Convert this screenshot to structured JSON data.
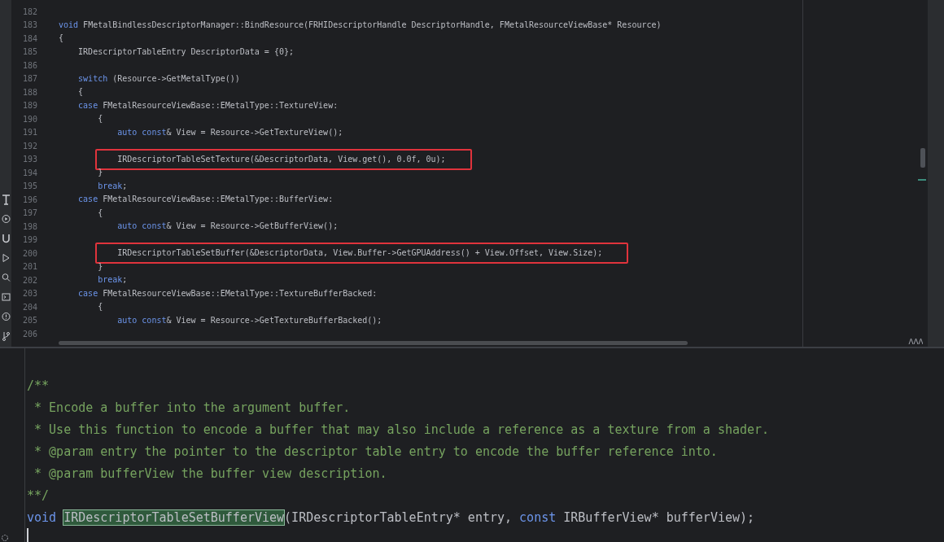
{
  "editor": {
    "lines": [
      {
        "number": "182"
      },
      {
        "number": "183",
        "tokens": [
          {
            "kind": "keyword",
            "text": "void"
          },
          {
            "kind": "plain",
            "text": " FMetalBindlessDescriptorManager::BindResource(FRHIDescriptorHandle DescriptorHandle, FMetalResourceViewBase* Resource)"
          }
        ]
      },
      {
        "number": "184",
        "tokens": [
          {
            "kind": "plain",
            "text": "{"
          }
        ]
      },
      {
        "number": "185",
        "tokens": [
          {
            "kind": "plain",
            "text": "    IRDescriptorTableEntry DescriptorData = {0};"
          }
        ]
      },
      {
        "number": "186"
      },
      {
        "number": "187",
        "tokens": [
          {
            "kind": "keyword",
            "text": "    switch"
          },
          {
            "kind": "plain",
            "text": " (Resource->GetMetalType())"
          }
        ]
      },
      {
        "number": "188",
        "tokens": [
          {
            "kind": "plain",
            "text": "    {"
          }
        ]
      },
      {
        "number": "189",
        "tokens": [
          {
            "kind": "keyword",
            "text": "    case"
          },
          {
            "kind": "plain",
            "text": " FMetalResourceViewBase::EMetalType::TextureView:"
          }
        ]
      },
      {
        "number": "190",
        "tokens": [
          {
            "kind": "plain",
            "text": "        {"
          }
        ]
      },
      {
        "number": "191",
        "tokens": [
          {
            "kind": "keyword",
            "text": "            auto const"
          },
          {
            "kind": "plain",
            "text": "& View = Resource->GetTextureView();"
          }
        ]
      },
      {
        "number": "192"
      },
      {
        "number": "193",
        "boxed": true,
        "tokens": [
          {
            "kind": "plain",
            "text": "            IRDescriptorTableSetTexture(&DescriptorData, View.get(), 0.0f, 0u);"
          }
        ]
      },
      {
        "number": "194",
        "tokens": [
          {
            "kind": "plain",
            "text": "        }"
          }
        ]
      },
      {
        "number": "195",
        "tokens": [
          {
            "kind": "keyword",
            "text": "        break"
          },
          {
            "kind": "plain",
            "text": ";"
          }
        ]
      },
      {
        "number": "196",
        "tokens": [
          {
            "kind": "keyword",
            "text": "    case"
          },
          {
            "kind": "plain",
            "text": " FMetalResourceViewBase::EMetalType::BufferView:"
          }
        ]
      },
      {
        "number": "197",
        "tokens": [
          {
            "kind": "plain",
            "text": "        {"
          }
        ]
      },
      {
        "number": "198",
        "tokens": [
          {
            "kind": "keyword",
            "text": "            auto const"
          },
          {
            "kind": "plain",
            "text": "& View = Resource->GetBufferView();"
          }
        ]
      },
      {
        "number": "199"
      },
      {
        "number": "200",
        "boxed": true,
        "tokens": [
          {
            "kind": "plain",
            "text": "            IRDescriptorTableSetBuffer(&DescriptorData, View.Buffer->GetGPUAddress() + View.Offset, View.Size);"
          }
        ]
      },
      {
        "number": "201",
        "tokens": [
          {
            "kind": "plain",
            "text": "        }"
          }
        ]
      },
      {
        "number": "202",
        "tokens": [
          {
            "kind": "keyword",
            "text": "        break"
          },
          {
            "kind": "plain",
            "text": ";"
          }
        ]
      },
      {
        "number": "203",
        "tokens": [
          {
            "kind": "keyword",
            "text": "    case"
          },
          {
            "kind": "plain",
            "text": " FMetalResourceViewBase::EMetalType::TextureBufferBacked:"
          }
        ]
      },
      {
        "number": "204",
        "tokens": [
          {
            "kind": "plain",
            "text": "        {"
          }
        ]
      },
      {
        "number": "205",
        "tokens": [
          {
            "kind": "keyword",
            "text": "            auto const"
          },
          {
            "kind": "plain",
            "text": "& View = Resource->GetTextureBufferBacked();"
          }
        ]
      },
      {
        "number": "206"
      }
    ]
  },
  "preview": {
    "lines": [
      {
        "tokens": [
          {
            "kind": "comment",
            "text": "/**"
          }
        ]
      },
      {
        "tokens": [
          {
            "kind": "comment",
            "text": " * Encode a buffer into the argument buffer."
          }
        ]
      },
      {
        "tokens": [
          {
            "kind": "comment",
            "text": " * Use this function to encode a buffer that may also include a reference as a texture from a shader."
          }
        ]
      },
      {
        "tokens": [
          {
            "kind": "comment",
            "text": " * @param entry the pointer to the descriptor table entry to encode the buffer reference into."
          }
        ]
      },
      {
        "tokens": [
          {
            "kind": "comment",
            "text": " * @param bufferView the buffer view description."
          }
        ]
      },
      {
        "tokens": [
          {
            "kind": "comment",
            "text": "**/"
          }
        ]
      },
      {
        "tokens": [
          {
            "kind": "keyword",
            "text": "void "
          },
          {
            "kind": "match",
            "text": "IRDescriptorTableSetBufferView"
          },
          {
            "kind": "plain",
            "text": "(IRDescriptorTableEntry* entry, "
          },
          {
            "kind": "keyword",
            "text": "const"
          },
          {
            "kind": "plain",
            "text": " IRBufferView* bufferView);"
          }
        ]
      }
    ]
  }
}
